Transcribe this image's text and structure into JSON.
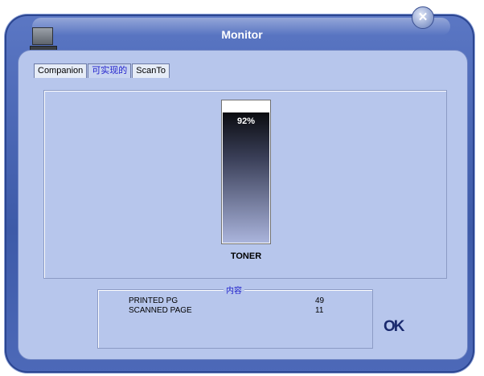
{
  "window": {
    "title": "Monitor"
  },
  "close_icon": "✕",
  "tabs": [
    {
      "label": "Companion",
      "active": false
    },
    {
      "label": "可实现的",
      "active": true
    },
    {
      "label": "ScanTo",
      "active": false
    }
  ],
  "toner": {
    "percent_label": "92%",
    "level": 0.92,
    "label": "TONER"
  },
  "info": {
    "legend": "内容",
    "rows": [
      {
        "label": "PRINTED PG",
        "value": "49"
      },
      {
        "label": "SCANNED PAGE",
        "value": "11"
      }
    ]
  },
  "ok_label": "OK",
  "colors": {
    "accent_tab": "#2222cc",
    "frame": "#3d5aa8",
    "panel": "#b7c6ec"
  }
}
